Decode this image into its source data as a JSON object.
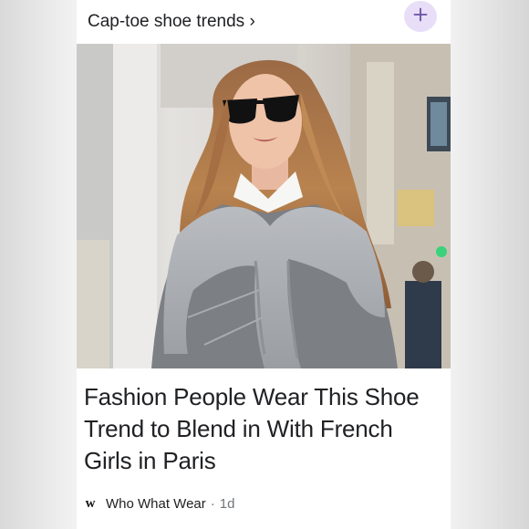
{
  "topic": {
    "title": "Cap-toe shoe trends ›"
  },
  "article": {
    "headline": "Fashion People Wear This Shoe Trend to Blend in With French Girls in Paris",
    "source_logo": "w",
    "source_name": "Who What Wear",
    "separator": "·",
    "age": "1d",
    "image_alt": "Woman with long wavy auburn hair wearing dark sunglasses, a grey sweater with a knitted grey jumper knotted over her shoulders, on a city street"
  },
  "icons": {
    "follow": "plus-icon",
    "source": "who-what-wear-logo-icon"
  },
  "colors": {
    "accent_bg": "#e8def8",
    "accent_fg": "#6750a4",
    "text": "#202124",
    "muted": "#70757a"
  }
}
